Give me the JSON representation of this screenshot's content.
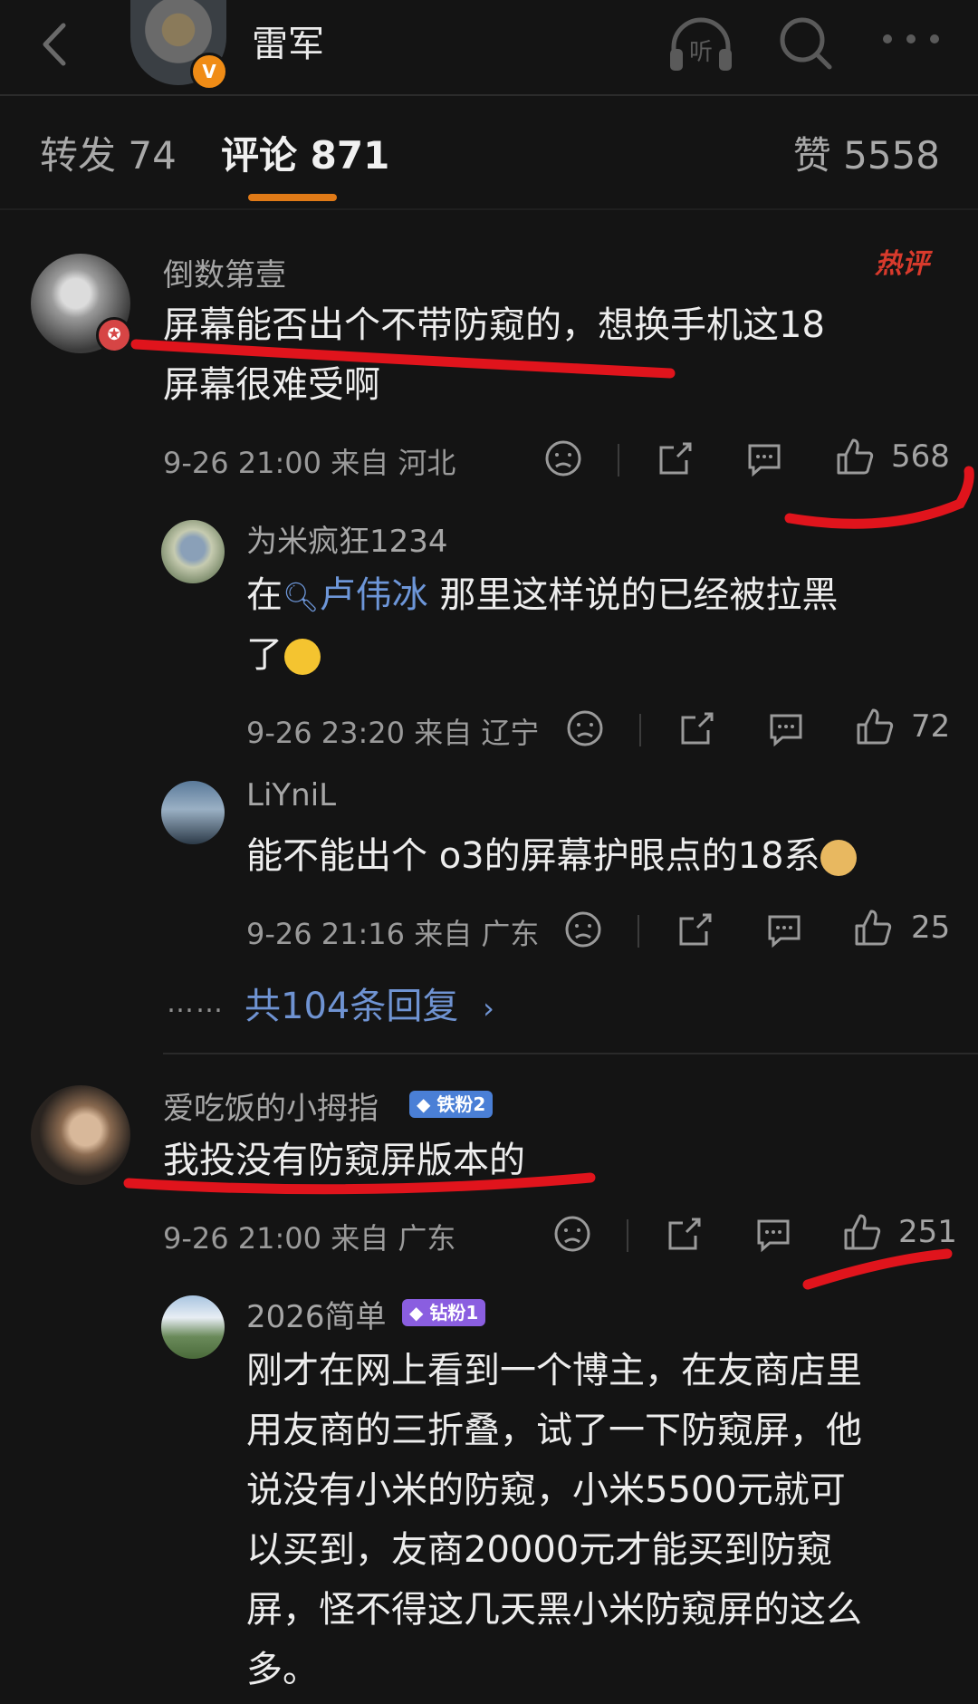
{
  "header": {
    "title": "雷军",
    "verified_badge": "V",
    "listen_label": "听",
    "icons": [
      "back-icon",
      "listen-icon",
      "search-icon",
      "more-icon"
    ]
  },
  "tabs": [
    {
      "label": "转发 74"
    },
    {
      "label": "评论 871"
    },
    {
      "label": "赞 5558"
    }
  ],
  "hot_label": "热评",
  "comments": [
    {
      "name": "倒数第壹",
      "text_line1": "屏幕能否出个不带防窥的，想换手机这18",
      "text_line2": "屏幕很难受啊",
      "meta": "9-26 21:00 来自 河北",
      "likes": "568",
      "replies": [
        {
          "name": "为米疯狂1234",
          "text_prefix": "在",
          "mention": "卢伟冰",
          "text_suffix": "那里这样说的已经被拉黑",
          "text_line2": "了",
          "meta": "9-26 23:20 来自 辽宁",
          "likes": "72"
        },
        {
          "name": "LiYniL",
          "text": "能不能出个 o3的屏幕护眼点的18系",
          "meta": "9-26 21:16 来自 广东",
          "likes": "25"
        }
      ],
      "more_replies": "共104条回复",
      "more_dots": "……"
    },
    {
      "name": "爱吃饭的小拇指",
      "badge": "铁粉2",
      "text": "我投没有防窥屏版本的",
      "meta": "9-26 21:00 来自 广东",
      "likes": "251",
      "replies": [
        {
          "name": "2026简单",
          "badge": "钻粉1",
          "lines": [
            "刚才在网上看到一个博主，在友商店里",
            "用友商的三折叠，试了一下防窥屏，他",
            "说没有小米的防窥，小米5500元就可",
            "以买到，友商20000元才能买到防窥",
            "屏，怪不得这几天黑小米防窥屏的这么",
            "多。"
          ]
        }
      ]
    }
  ],
  "colors": {
    "background": "#141414",
    "accent": "#e07a17",
    "mention": "#6d96d8",
    "annotation_red": "#e0141c",
    "badge_iron": "#4a7fd6",
    "badge_diamond": "#8a5ee0"
  }
}
